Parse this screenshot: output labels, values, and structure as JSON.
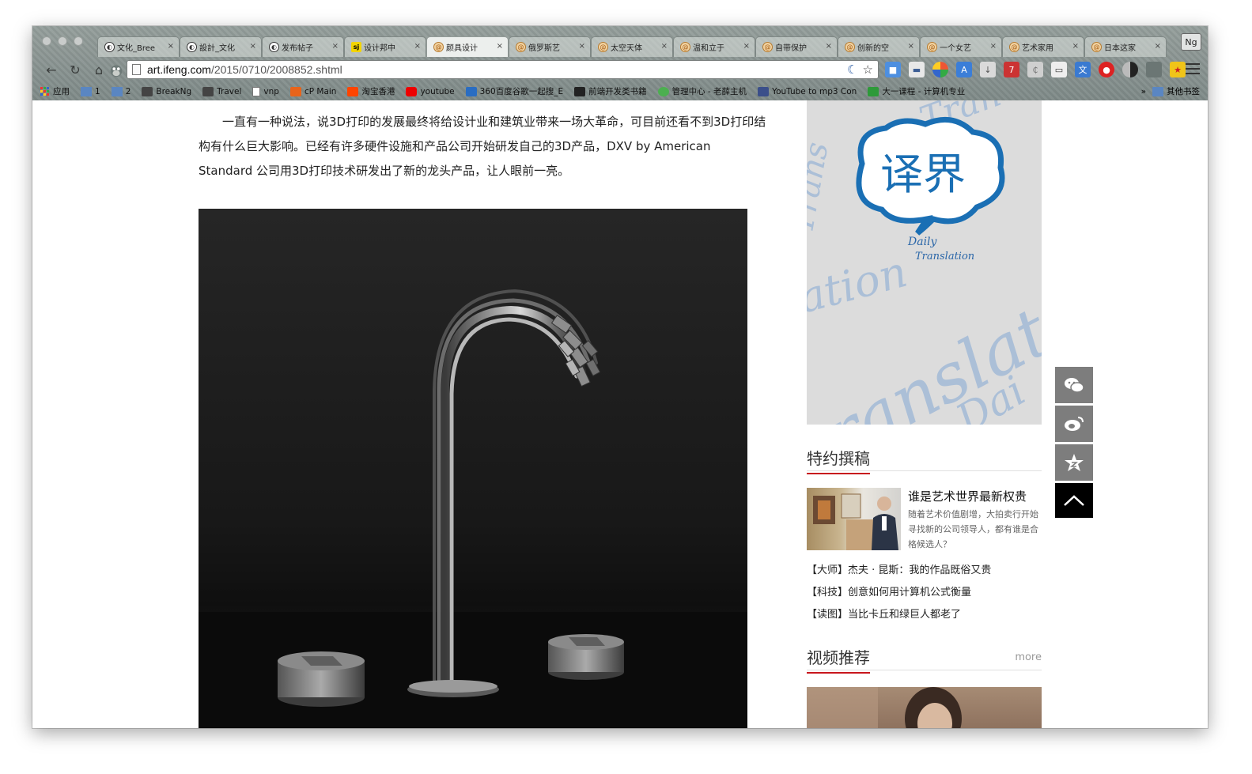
{
  "browser": {
    "tabs": [
      {
        "title": "文化_Bree",
        "icon": "ifeng-icon",
        "active": false
      },
      {
        "title": "設計_文化",
        "icon": "ifeng-icon",
        "active": false
      },
      {
        "title": "发布帖子",
        "icon": "ifeng-icon",
        "active": false
      },
      {
        "title": "设计邦中",
        "icon": "sjb-icon",
        "active": false
      },
      {
        "title": "颜具设计",
        "icon": "swirl-icon",
        "active": true
      },
      {
        "title": "俄罗斯艺",
        "icon": "swirl-icon",
        "active": false
      },
      {
        "title": "太空天体",
        "icon": "swirl-icon",
        "active": false
      },
      {
        "title": "温和立于",
        "icon": "swirl-icon",
        "active": false
      },
      {
        "title": "自带保护",
        "icon": "swirl-icon",
        "active": false
      },
      {
        "title": "创新的空",
        "icon": "swirl-icon",
        "active": false
      },
      {
        "title": "一个女艺",
        "icon": "swirl-icon",
        "active": false
      },
      {
        "title": "艺术家用",
        "icon": "swirl-icon",
        "active": false
      },
      {
        "title": "日本这家",
        "icon": "swirl-icon",
        "active": false
      }
    ],
    "profile_label": "Ng",
    "url_host": "art.ifeng.com",
    "url_path": "/2015/0710/2008852.shtml",
    "bookmarks": [
      {
        "label": "应用",
        "icon": "apps-icon"
      },
      {
        "label": "1",
        "icon": "folder-icon"
      },
      {
        "label": "2",
        "icon": "folder-icon"
      },
      {
        "label": "BreakNg",
        "icon": "cube-icon"
      },
      {
        "label": "Travel",
        "icon": "cube-icon"
      },
      {
        "label": "vnp",
        "icon": "page-icon"
      },
      {
        "label": "cP Main",
        "icon": "cpanel-icon"
      },
      {
        "label": "淘宝香港",
        "icon": "taobao-icon"
      },
      {
        "label": "youtube",
        "icon": "youtube-icon"
      },
      {
        "label": "360百度谷歌一起搜_E",
        "icon": "360-icon"
      },
      {
        "label": "前端开发类书籍",
        "icon": "ck-icon"
      },
      {
        "label": "管理中心 - 老薛主机",
        "icon": "star-icon"
      },
      {
        "label": "YouTube to mp3 Con",
        "icon": "mp3-icon"
      },
      {
        "label": "大一课程 - 计算机专业",
        "icon": "course-icon"
      }
    ],
    "other_bookmarks": "其他书签",
    "overflow": "»"
  },
  "article": {
    "paragraph": "一直有一种说法，说3D打印的发展最终将给设计业和建筑业带来一场大革命，可目前还看不到3D打印结构有什么巨大影响。已经有许多硬件设施和产品公司开始研发自己的3D产品，DXV by American Standard 公司用3D打印技术研发出了新的龙头产品，让人眼前一亮。"
  },
  "sidebar": {
    "banner": {
      "logo_text": "译界",
      "tagline_line1": "Daily",
      "tagline_line2": "Translation",
      "bg_words": [
        "Tran",
        "Trans",
        "ation",
        "ranslat",
        "Dai"
      ]
    },
    "featured": {
      "section_title": "特约撰稿",
      "headline": "谁是艺术世界最新权贵",
      "summary": "随着艺术价值剧增，大拍卖行开始寻找新的公司领导人，都有谁是合格候选人？",
      "links": [
        "【大师】杰夫 · 昆斯：我的作品既俗又贵",
        "【科技】创意如何用计算机公式衡量",
        "【读图】当比卡丘和绿巨人都老了"
      ]
    },
    "video": {
      "section_title": "视频推荐",
      "more_label": "more"
    }
  },
  "float_bar": [
    "wechat-icon",
    "weibo-icon",
    "favorite-icon",
    "back-to-top-icon"
  ],
  "colors": {
    "accent_red": "#c8161d",
    "logo_blue": "#1a6fb4",
    "float_gray": "#7d7d7d"
  }
}
